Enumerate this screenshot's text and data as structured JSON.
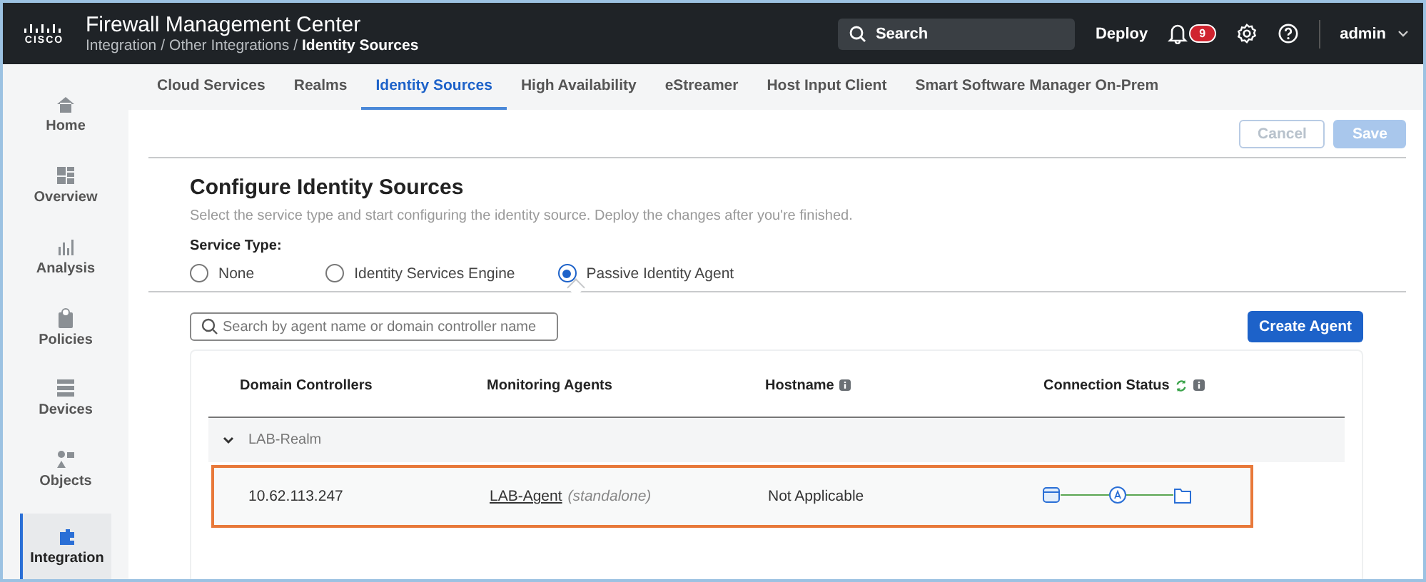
{
  "header": {
    "logo": "CISCO",
    "title": "Firewall Management Center",
    "breadcrumb": [
      {
        "text": "Integration",
        "kind": "link"
      },
      {
        "text": "/",
        "kind": "separator"
      },
      {
        "text": "Other Integrations",
        "kind": "link"
      },
      {
        "text": "/",
        "kind": "separator"
      },
      {
        "text": "Identity Sources",
        "kind": "current"
      }
    ],
    "search": "Search",
    "deploy": "Deploy",
    "notifications": "9",
    "user": "admin"
  },
  "sidebar": {
    "items": [
      {
        "label": "Home",
        "kind": "home",
        "selected": false
      },
      {
        "label": "Overview",
        "kind": "overview",
        "selected": false
      },
      {
        "label": "Analysis",
        "kind": "analysis",
        "selected": false
      },
      {
        "label": "Policies",
        "kind": "policies",
        "selected": false
      },
      {
        "label": "Devices",
        "kind": "devices",
        "selected": false
      },
      {
        "label": "Objects",
        "kind": "objects",
        "selected": false
      },
      {
        "label": "Integration",
        "kind": "integration",
        "selected": true
      }
    ]
  },
  "tabs": [
    {
      "label": "Cloud Services",
      "selected": false
    },
    {
      "label": "Realms",
      "selected": false
    },
    {
      "label": "Identity Sources",
      "selected": true
    },
    {
      "label": "High Availability",
      "selected": false
    },
    {
      "label": "eStreamer",
      "selected": false
    },
    {
      "label": "Host Input Client",
      "selected": false
    },
    {
      "label": "Smart Software Manager On-Prem",
      "selected": false
    }
  ],
  "actions": [
    {
      "label": "Cancel",
      "kind": "secondary",
      "disabled": true
    },
    {
      "label": "Save",
      "kind": "primary",
      "disabled": true
    }
  ],
  "page": {
    "title": "Configure Identity Sources",
    "description": "Select the service type and start configuring the identity source. Deploy the changes after you're finished.",
    "service_type_label": "Service Type:",
    "options": [
      {
        "label": "None",
        "selected": false
      },
      {
        "label": "Identity Services Engine",
        "selected": false
      },
      {
        "label": "Passive Identity Agent",
        "selected": true
      }
    ]
  },
  "search": {
    "placeholder": "Search by agent name or domain controller name"
  },
  "create_button": "Create Agent",
  "table": {
    "columns": [
      {
        "label": "Domain Controllers",
        "info": false,
        "refresh": false
      },
      {
        "label": "Monitoring Agents",
        "info": false,
        "refresh": false
      },
      {
        "label": "Hostname",
        "info": true,
        "refresh": false
      },
      {
        "label": "Connection Status",
        "info": true,
        "refresh": true
      }
    ],
    "groups": [
      {
        "name": "LAB-Realm",
        "expanded": true,
        "rows": [
          {
            "domain_controller": "10.62.113.247",
            "agent": "LAB-Agent",
            "agent_note": "(standalone)",
            "hostname": "Not Applicable",
            "highlighted": true,
            "connected": true
          }
        ]
      }
    ]
  }
}
